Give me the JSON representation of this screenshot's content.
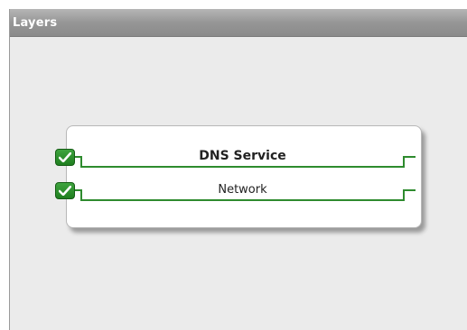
{
  "window": {
    "title": "Layers"
  },
  "layers": [
    {
      "label": "DNS Service",
      "checked": true,
      "icon": "checkmark-icon"
    },
    {
      "label": "Network",
      "checked": true,
      "icon": "checkmark-icon"
    }
  ],
  "colors": {
    "accent_green": "#2e8b2e",
    "checkbox_green": "#1f7f1f",
    "titlebar_gray": "#969696",
    "background": "#ebebeb"
  }
}
